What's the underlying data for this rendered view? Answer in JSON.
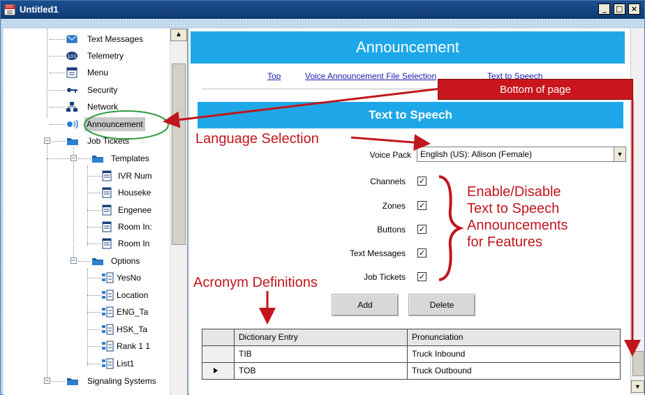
{
  "window": {
    "title": "Untitled1",
    "minimize_glyph": "_",
    "maximize_glyph": "□",
    "close_glyph": "×"
  },
  "tree": {
    "items": [
      {
        "label": "Text Messages",
        "icon": "envelope-icon"
      },
      {
        "label": "Telemetry",
        "icon": "telemetry-icon"
      },
      {
        "label": "Menu",
        "icon": "menu-icon"
      },
      {
        "label": "Security",
        "icon": "key-icon"
      },
      {
        "label": "Network",
        "icon": "network-icon"
      },
      {
        "label": "Announcement",
        "icon": "speaker-icon"
      },
      {
        "label": "Job Tickets",
        "icon": "folder-icon"
      },
      {
        "label": "Templates",
        "icon": "folder-icon"
      },
      {
        "label": "IVR Num",
        "icon": "document-icon"
      },
      {
        "label": "Houseke",
        "icon": "document-icon"
      },
      {
        "label": "Engenee",
        "icon": "document-icon"
      },
      {
        "label": "Room In:",
        "icon": "document-icon"
      },
      {
        "label": "Room In",
        "icon": "document-icon"
      },
      {
        "label": "Options",
        "icon": "folder-icon"
      },
      {
        "label": "YesNo",
        "icon": "options-icon"
      },
      {
        "label": "Location",
        "icon": "options-icon"
      },
      {
        "label": "ENG_Ta",
        "icon": "options-icon"
      },
      {
        "label": "HSK_Ta",
        "icon": "options-icon"
      },
      {
        "label": "Rank 1 1",
        "icon": "options-icon"
      },
      {
        "label": "List1",
        "icon": "options-icon"
      },
      {
        "label": "Signaling Systems",
        "icon": "folder-icon"
      }
    ]
  },
  "content": {
    "banner_title": "Announcement",
    "nav_links": [
      "Top",
      "Voice Announcement File Selection",
      "Text to Speech"
    ],
    "section_title": "Text to Speech",
    "voice_pack_label": "Voice Pack",
    "voice_pack_value": "English (US): Allison (Female)",
    "features": [
      {
        "label": "Channels",
        "checked": true
      },
      {
        "label": "Zones",
        "checked": true
      },
      {
        "label": "Buttons",
        "checked": true
      },
      {
        "label": "Text Messages",
        "checked": true
      },
      {
        "label": "Job Tickets",
        "checked": true
      }
    ],
    "add_button": "Add",
    "delete_button": "Delete",
    "grid": {
      "columns": [
        "Dictionary Entry",
        "Pronunciation"
      ],
      "rows": [
        {
          "entry": "TIB",
          "pronunciation": "Truck Inbound",
          "current": false
        },
        {
          "entry": "TOB",
          "pronunciation": "Truck Outbound",
          "current": true
        }
      ]
    }
  },
  "annotations": {
    "bottom_of_page": "Bottom of page",
    "language_selection": "Language Selection",
    "enable_disable": [
      "Enable/Disable",
      "Text to Speech",
      "Announcements",
      "for Features"
    ],
    "acronym_definitions": "Acronym Definitions",
    "color": "#c0161c"
  },
  "colors": {
    "banner": "#1ea7e8",
    "titlebar": "#0f3a72",
    "link": "#1a1aa6"
  }
}
